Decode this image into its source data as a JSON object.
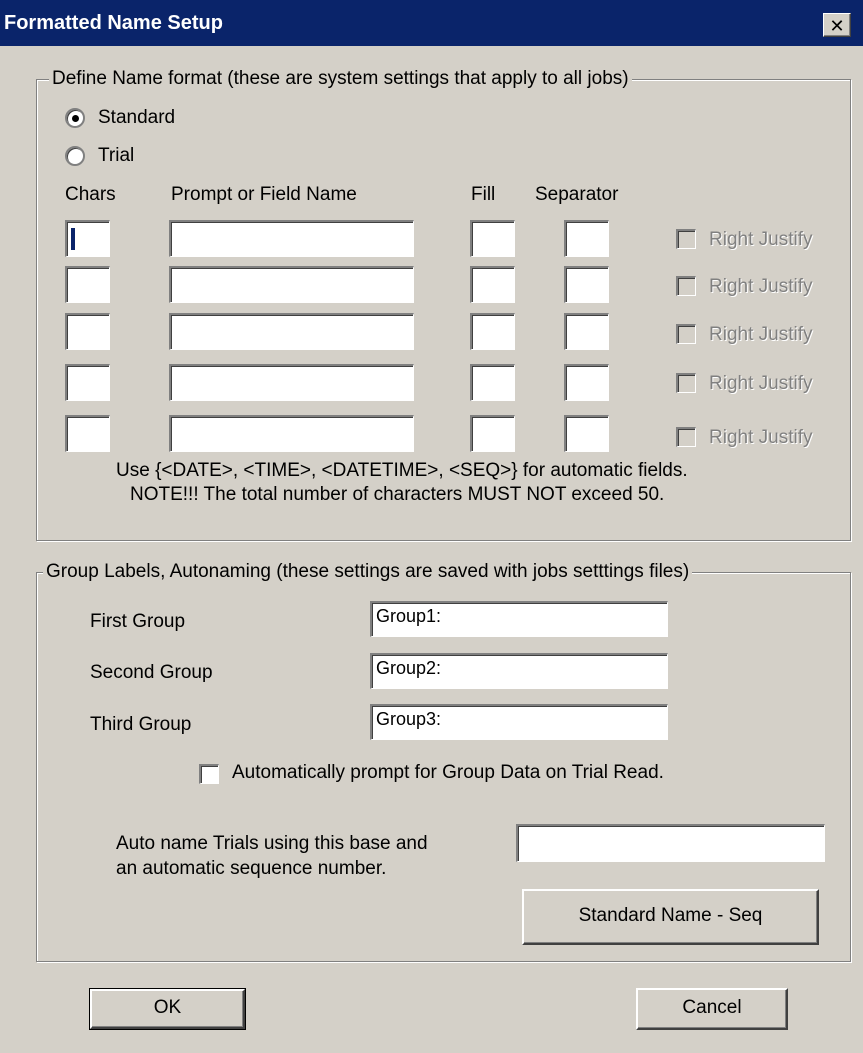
{
  "window": {
    "title": "Formatted Name Setup",
    "close_glyph": "✕"
  },
  "format_group": {
    "legend": "Define Name format (these are system settings that apply to all jobs)",
    "radios": [
      {
        "label": "Standard",
        "checked": true
      },
      {
        "label": "Trial",
        "checked": false
      }
    ],
    "headers": {
      "chars": "Chars",
      "prompt": "Prompt or Field Name",
      "fill": "Fill",
      "separator": "Separator"
    },
    "rows": [
      {
        "chars": "",
        "prompt": "",
        "fill": "",
        "separator": "",
        "right_justify": "Right Justify"
      },
      {
        "chars": "",
        "prompt": "",
        "fill": "",
        "separator": "",
        "right_justify": "Right Justify"
      },
      {
        "chars": "",
        "prompt": "",
        "fill": "",
        "separator": "",
        "right_justify": "Right Justify"
      },
      {
        "chars": "",
        "prompt": "",
        "fill": "",
        "separator": "",
        "right_justify": "Right Justify"
      },
      {
        "chars": "",
        "prompt": "",
        "fill": "",
        "separator": "",
        "right_justify": "Right Justify"
      }
    ],
    "note_line1": "Use {<DATE>, <TIME>, <DATETIME>, <SEQ>} for automatic fields.",
    "note_line2": "NOTE!!!   The total number of characters MUST NOT exceed 50."
  },
  "labels_group": {
    "legend": "Group Labels, Autonaming (these settings are saved with jobs setttings files)",
    "groups": [
      {
        "label": "First Group",
        "value": "Group1:"
      },
      {
        "label": "Second Group",
        "value": "Group2:"
      },
      {
        "label": "Third Group",
        "value": "Group3:"
      }
    ],
    "auto_prompt_label": "Automatically prompt for Group Data on Trial Read.",
    "auto_name_line1": "Auto name Trials using this base and",
    "auto_name_line2": "an automatic sequence number.",
    "auto_name_value": "",
    "standard_seq_button": "Standard Name - Seq"
  },
  "footer": {
    "ok_button": "OK",
    "cancel_button": "Cancel"
  },
  "colors": {
    "face": "#d4d0c8",
    "titlebar": "#0a246a",
    "disabled_text": "#808080"
  }
}
